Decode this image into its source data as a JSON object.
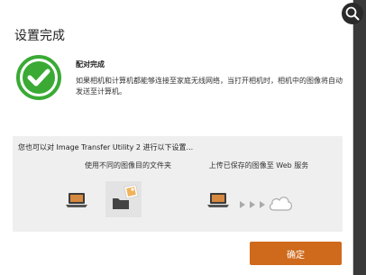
{
  "dialog": {
    "title": "设置完成",
    "subtitle": "配对完成",
    "description": "如果相机和计算机都能够连接至家庭无线网络，当打开相机时，相机中的图像将自动发送至计算机。"
  },
  "panel": {
    "heading": "您也可以对 Image Transfer Utility 2 进行以下设置...",
    "option1_label": "使用不同的图像目的文件夹",
    "option2_label": "上传已保存的图像至 Web 服务"
  },
  "footer": {
    "ok_label": "确定"
  },
  "colors": {
    "accent": "#cf6a1c",
    "success": "#3aaa35"
  },
  "icons": [
    "check-circle-icon",
    "laptop-icon",
    "folder-icon",
    "photo-icon",
    "arrows-icon",
    "cloud-icon",
    "zoom-icon"
  ]
}
